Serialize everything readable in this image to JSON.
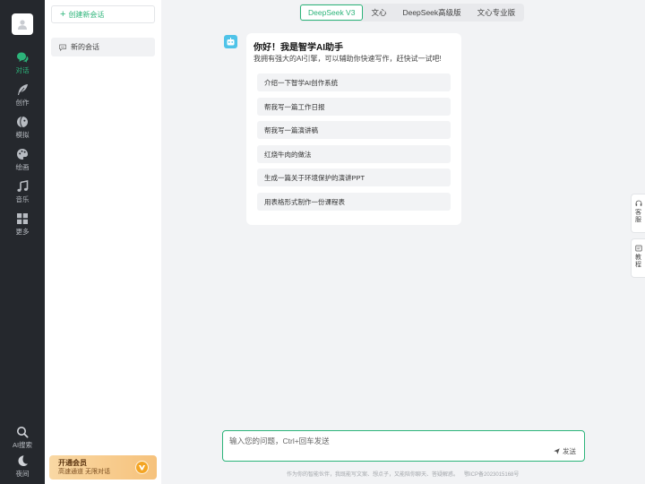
{
  "sidebar": {
    "items": [
      {
        "label": "对话",
        "icon": "chat-icon",
        "active": true
      },
      {
        "label": "创作",
        "icon": "feather-icon",
        "active": false
      },
      {
        "label": "模拟",
        "icon": "mask-icon",
        "active": false
      },
      {
        "label": "绘画",
        "icon": "palette-icon",
        "active": false
      },
      {
        "label": "音乐",
        "icon": "music-note-icon",
        "active": false
      },
      {
        "label": "更多",
        "icon": "grid-icon",
        "active": false
      }
    ],
    "bottom": [
      {
        "label": "AI搜索",
        "icon": "search-icon"
      },
      {
        "label": "夜间",
        "icon": "moon-icon"
      }
    ]
  },
  "panel": {
    "new_chat_label": "创建新会话",
    "sessions": [
      {
        "label": "新的会话"
      }
    ],
    "vip": {
      "title": "开通会员",
      "subtitle": "高速通道 无限对话"
    }
  },
  "tabs": [
    {
      "label": "DeepSeek V3",
      "active": true
    },
    {
      "label": "文心",
      "active": false
    },
    {
      "label": "DeepSeek高级版",
      "active": false
    },
    {
      "label": "文心专业版",
      "active": false
    }
  ],
  "welcome": {
    "title": "你好！我是智学AI助手",
    "subtitle": "我拥有强大的AI引擎，可以辅助你快速写作，赶快试一试吧!",
    "suggestions": [
      "介绍一下智学AI创作系统",
      "帮我写一篇工作日报",
      "帮我写一篇演讲稿",
      "红烧牛肉的做法",
      "生成一篇关于环境保护的演讲PPT",
      "用表格形式制作一份课程表"
    ]
  },
  "float_buttons": [
    {
      "label": "客服",
      "icon": "headset-icon"
    },
    {
      "label": "教程",
      "icon": "book-icon"
    }
  ],
  "input": {
    "placeholder": "输入您的问题，Ctrl+回车发送",
    "value": "",
    "send_label": "发送"
  },
  "footer": {
    "text": "作为你的智能伙伴，我既能写文案、想点子，又能陪你聊天、答疑解惑。",
    "icp": "鄂ICP备2023015168号"
  },
  "colors": {
    "accent": "#2cb47a",
    "rail_bg": "#25282d",
    "page_bg": "#f2f3f5"
  }
}
